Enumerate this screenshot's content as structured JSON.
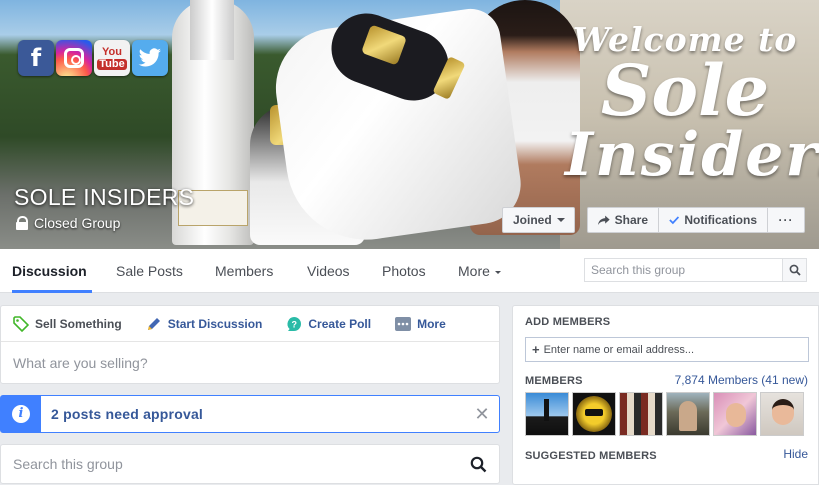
{
  "cover": {
    "welcome_line1": "Welcome to",
    "welcome_line2": "Sole",
    "welcome_line3": "Insiders",
    "socials": [
      "facebook-icon",
      "instagram-icon",
      "youtube-icon",
      "twitter-icon"
    ],
    "youtube_text_1": "You",
    "youtube_text_2": "Tube",
    "facebook_letter": "f",
    "twitter_glyph": "🐦"
  },
  "group": {
    "name": "SOLE INSIDERS",
    "privacy": "Closed Group"
  },
  "actions": {
    "joined": "Joined",
    "share": "Share",
    "notifications": "Notifications",
    "more": "···"
  },
  "tabs": [
    {
      "label": "Discussion",
      "active": true
    },
    {
      "label": "Sale Posts"
    },
    {
      "label": "Members"
    },
    {
      "label": "Videos"
    },
    {
      "label": "Photos"
    },
    {
      "label": "More"
    }
  ],
  "search": {
    "placeholder": "Search this group"
  },
  "composer": {
    "actions": [
      {
        "label": "Sell Something",
        "icon": "tag-icon"
      },
      {
        "label": "Start Discussion",
        "icon": "pencil-icon"
      },
      {
        "label": "Create Poll",
        "icon": "poll-icon"
      },
      {
        "label": "More",
        "icon": "more-icon"
      }
    ],
    "placeholder": "What are you selling?"
  },
  "approval": {
    "icon": "i",
    "text": "2 posts need approval",
    "close": "✕"
  },
  "bottom_search": {
    "placeholder": "Search this group"
  },
  "sidebar": {
    "add_members_title": "ADD MEMBERS",
    "add_members_placeholder": "Enter name or email address...",
    "add_plus": "+",
    "members_title": "MEMBERS",
    "members_count": "7,874 Members (41 new)",
    "suggested_title": "SUGGESTED MEMBERS",
    "hide": "Hide"
  },
  "colors": {
    "accent": "#4080ff",
    "link": "#365899",
    "facebook": "#3b5998"
  }
}
